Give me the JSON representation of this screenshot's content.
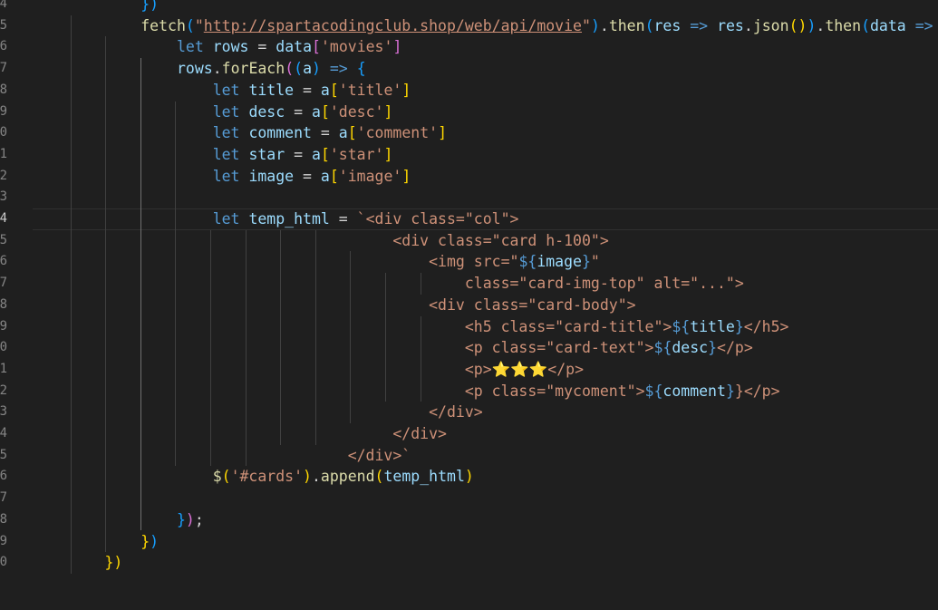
{
  "editor": {
    "line_numbers": [
      "4",
      "5",
      "6",
      "7",
      "8",
      "9",
      "0",
      "1",
      "2",
      "3",
      "4",
      "5",
      "6",
      "7",
      "8",
      "9",
      "0",
      "1",
      "2",
      "3",
      "4",
      "5",
      "6",
      "7",
      "8",
      "9",
      "0"
    ],
    "active_line_number": "4",
    "lines": [
      {
        "ln": "4",
        "segments": [
          {
            "t": "            ",
            "c": ""
          },
          {
            "t": "})",
            "c": "b3"
          }
        ]
      },
      {
        "ln": "5",
        "segments": [
          {
            "t": "            ",
            "c": ""
          },
          {
            "t": "fetch",
            "c": "fn"
          },
          {
            "t": "(",
            "c": "b3"
          },
          {
            "t": "\"",
            "c": "str"
          },
          {
            "t": "http://spartacodingclub.shop/web/api/movie",
            "c": "url"
          },
          {
            "t": "\"",
            "c": "str"
          },
          {
            "t": ")",
            "c": "b3"
          },
          {
            "t": ".",
            "c": "op"
          },
          {
            "t": "then",
            "c": "fn"
          },
          {
            "t": "(",
            "c": "b3"
          },
          {
            "t": "res",
            "c": "var"
          },
          {
            "t": " ",
            "c": ""
          },
          {
            "t": "=>",
            "c": "kw"
          },
          {
            "t": " ",
            "c": ""
          },
          {
            "t": "res",
            "c": "var"
          },
          {
            "t": ".",
            "c": "op"
          },
          {
            "t": "json",
            "c": "fn"
          },
          {
            "t": "(",
            "c": "b1"
          },
          {
            "t": ")",
            "c": "b1"
          },
          {
            "t": ")",
            "c": "b3"
          },
          {
            "t": ".",
            "c": "op"
          },
          {
            "t": "then",
            "c": "fn"
          },
          {
            "t": "(",
            "c": "b3"
          },
          {
            "t": "data",
            "c": "var"
          },
          {
            "t": " ",
            "c": ""
          },
          {
            "t": "=>",
            "c": "kw"
          },
          {
            "t": " ",
            "c": ""
          },
          {
            "t": "{",
            "c": "b1"
          }
        ]
      },
      {
        "ln": "6",
        "segments": [
          {
            "t": "                ",
            "c": ""
          },
          {
            "t": "let",
            "c": "kw"
          },
          {
            "t": " ",
            "c": ""
          },
          {
            "t": "rows",
            "c": "var"
          },
          {
            "t": " = ",
            "c": "op"
          },
          {
            "t": "data",
            "c": "var"
          },
          {
            "t": "[",
            "c": "b2"
          },
          {
            "t": "'movies'",
            "c": "str"
          },
          {
            "t": "]",
            "c": "b2"
          }
        ]
      },
      {
        "ln": "7",
        "segments": [
          {
            "t": "                ",
            "c": ""
          },
          {
            "t": "rows",
            "c": "var"
          },
          {
            "t": ".",
            "c": "op"
          },
          {
            "t": "forEach",
            "c": "fn"
          },
          {
            "t": "(",
            "c": "b2"
          },
          {
            "t": "(",
            "c": "b3"
          },
          {
            "t": "a",
            "c": "var"
          },
          {
            "t": ")",
            "c": "b3"
          },
          {
            "t": " ",
            "c": ""
          },
          {
            "t": "=>",
            "c": "kw"
          },
          {
            "t": " ",
            "c": ""
          },
          {
            "t": "{",
            "c": "b3"
          }
        ]
      },
      {
        "ln": "8",
        "segments": [
          {
            "t": "                    ",
            "c": ""
          },
          {
            "t": "let",
            "c": "kw"
          },
          {
            "t": " ",
            "c": ""
          },
          {
            "t": "title",
            "c": "var"
          },
          {
            "t": " = ",
            "c": "op"
          },
          {
            "t": "a",
            "c": "var"
          },
          {
            "t": "[",
            "c": "b1"
          },
          {
            "t": "'title'",
            "c": "str"
          },
          {
            "t": "]",
            "c": "b1"
          }
        ]
      },
      {
        "ln": "9",
        "segments": [
          {
            "t": "                    ",
            "c": ""
          },
          {
            "t": "let",
            "c": "kw"
          },
          {
            "t": " ",
            "c": ""
          },
          {
            "t": "desc",
            "c": "var"
          },
          {
            "t": " = ",
            "c": "op"
          },
          {
            "t": "a",
            "c": "var"
          },
          {
            "t": "[",
            "c": "b1"
          },
          {
            "t": "'desc'",
            "c": "str"
          },
          {
            "t": "]",
            "c": "b1"
          }
        ]
      },
      {
        "ln": "0",
        "segments": [
          {
            "t": "                    ",
            "c": ""
          },
          {
            "t": "let",
            "c": "kw"
          },
          {
            "t": " ",
            "c": ""
          },
          {
            "t": "comment",
            "c": "var"
          },
          {
            "t": " = ",
            "c": "op"
          },
          {
            "t": "a",
            "c": "var"
          },
          {
            "t": "[",
            "c": "b1"
          },
          {
            "t": "'comment'",
            "c": "str"
          },
          {
            "t": "]",
            "c": "b1"
          }
        ]
      },
      {
        "ln": "1",
        "segments": [
          {
            "t": "                    ",
            "c": ""
          },
          {
            "t": "let",
            "c": "kw"
          },
          {
            "t": " ",
            "c": ""
          },
          {
            "t": "star",
            "c": "var"
          },
          {
            "t": " = ",
            "c": "op"
          },
          {
            "t": "a",
            "c": "var"
          },
          {
            "t": "[",
            "c": "b1"
          },
          {
            "t": "'star'",
            "c": "str"
          },
          {
            "t": "]",
            "c": "b1"
          }
        ]
      },
      {
        "ln": "2",
        "segments": [
          {
            "t": "                    ",
            "c": ""
          },
          {
            "t": "let",
            "c": "kw"
          },
          {
            "t": " ",
            "c": ""
          },
          {
            "t": "image",
            "c": "var"
          },
          {
            "t": " = ",
            "c": "op"
          },
          {
            "t": "a",
            "c": "var"
          },
          {
            "t": "[",
            "c": "b1"
          },
          {
            "t": "'image'",
            "c": "str"
          },
          {
            "t": "]",
            "c": "b1"
          }
        ]
      },
      {
        "ln": "3",
        "segments": []
      },
      {
        "ln": "4",
        "segments": [
          {
            "t": "                    ",
            "c": ""
          },
          {
            "t": "let",
            "c": "kw"
          },
          {
            "t": " ",
            "c": ""
          },
          {
            "t": "temp_html",
            "c": "var"
          },
          {
            "t": " = ",
            "c": "op"
          },
          {
            "t": "`<div class=\"col\">",
            "c": "str"
          }
        ]
      },
      {
        "ln": "5",
        "segments": [
          {
            "t": "                                        ",
            "c": ""
          },
          {
            "t": "<div class=\"card h-100\">",
            "c": "str"
          }
        ]
      },
      {
        "ln": "6",
        "segments": [
          {
            "t": "                                            ",
            "c": ""
          },
          {
            "t": "<img src=\"",
            "c": "str"
          },
          {
            "t": "${",
            "c": "tmpl-op"
          },
          {
            "t": "image",
            "c": "var"
          },
          {
            "t": "}",
            "c": "tmpl-op"
          },
          {
            "t": "\"",
            "c": "str"
          }
        ]
      },
      {
        "ln": "7",
        "segments": [
          {
            "t": "                                                ",
            "c": ""
          },
          {
            "t": "class=\"card-img-top\" alt=\"...\">",
            "c": "str"
          }
        ]
      },
      {
        "ln": "8",
        "segments": [
          {
            "t": "                                            ",
            "c": ""
          },
          {
            "t": "<div class=\"card-body\">",
            "c": "str"
          }
        ]
      },
      {
        "ln": "9",
        "segments": [
          {
            "t": "                                                ",
            "c": ""
          },
          {
            "t": "<h5 class=\"card-title\">",
            "c": "str"
          },
          {
            "t": "${",
            "c": "tmpl-op"
          },
          {
            "t": "title",
            "c": "var"
          },
          {
            "t": "}",
            "c": "tmpl-op"
          },
          {
            "t": "</h5>",
            "c": "str"
          }
        ]
      },
      {
        "ln": "0",
        "segments": [
          {
            "t": "                                                ",
            "c": ""
          },
          {
            "t": "<p class=\"card-text\">",
            "c": "str"
          },
          {
            "t": "${",
            "c": "tmpl-op"
          },
          {
            "t": "desc",
            "c": "var"
          },
          {
            "t": "}",
            "c": "tmpl-op"
          },
          {
            "t": "</p>",
            "c": "str"
          }
        ]
      },
      {
        "ln": "1",
        "segments": [
          {
            "t": "                                                ",
            "c": ""
          },
          {
            "t": "<p>",
            "c": "str"
          },
          {
            "t": "⭐⭐⭐",
            "c": "b1"
          },
          {
            "t": "</p>",
            "c": "str"
          }
        ]
      },
      {
        "ln": "2",
        "segments": [
          {
            "t": "                                                ",
            "c": ""
          },
          {
            "t": "<p class=\"mycoment\">",
            "c": "str"
          },
          {
            "t": "${",
            "c": "tmpl-op"
          },
          {
            "t": "comment",
            "c": "var"
          },
          {
            "t": "}",
            "c": "tmpl-op"
          },
          {
            "t": "}",
            "c": "str"
          },
          {
            "t": "</p>",
            "c": "str"
          }
        ]
      },
      {
        "ln": "3",
        "segments": [
          {
            "t": "                                            ",
            "c": ""
          },
          {
            "t": "</div>",
            "c": "str"
          }
        ]
      },
      {
        "ln": "4",
        "segments": [
          {
            "t": "                                        ",
            "c": ""
          },
          {
            "t": "</div>",
            "c": "str"
          }
        ]
      },
      {
        "ln": "5",
        "segments": [
          {
            "t": "                                   ",
            "c": ""
          },
          {
            "t": "</div>`",
            "c": "str"
          }
        ]
      },
      {
        "ln": "6",
        "segments": [
          {
            "t": "                    ",
            "c": ""
          },
          {
            "t": "$",
            "c": "fn"
          },
          {
            "t": "(",
            "c": "b1"
          },
          {
            "t": "'#cards'",
            "c": "str"
          },
          {
            "t": ")",
            "c": "b1"
          },
          {
            "t": ".",
            "c": "op"
          },
          {
            "t": "append",
            "c": "fn"
          },
          {
            "t": "(",
            "c": "b1"
          },
          {
            "t": "temp_html",
            "c": "var"
          },
          {
            "t": ")",
            "c": "b1"
          }
        ]
      },
      {
        "ln": "7",
        "segments": []
      },
      {
        "ln": "8",
        "segments": [
          {
            "t": "                ",
            "c": ""
          },
          {
            "t": "}",
            "c": "b3"
          },
          {
            "t": ")",
            "c": "b2"
          },
          {
            "t": ";",
            "c": "op"
          }
        ]
      },
      {
        "ln": "9",
        "segments": [
          {
            "t": "            ",
            "c": ""
          },
          {
            "t": "}",
            "c": "b1"
          },
          {
            "t": ")",
            "c": "b3"
          }
        ]
      },
      {
        "ln": "0",
        "segments": [
          {
            "t": "        ",
            "c": ""
          },
          {
            "t": "})",
            "c": "b1"
          }
        ]
      }
    ]
  }
}
